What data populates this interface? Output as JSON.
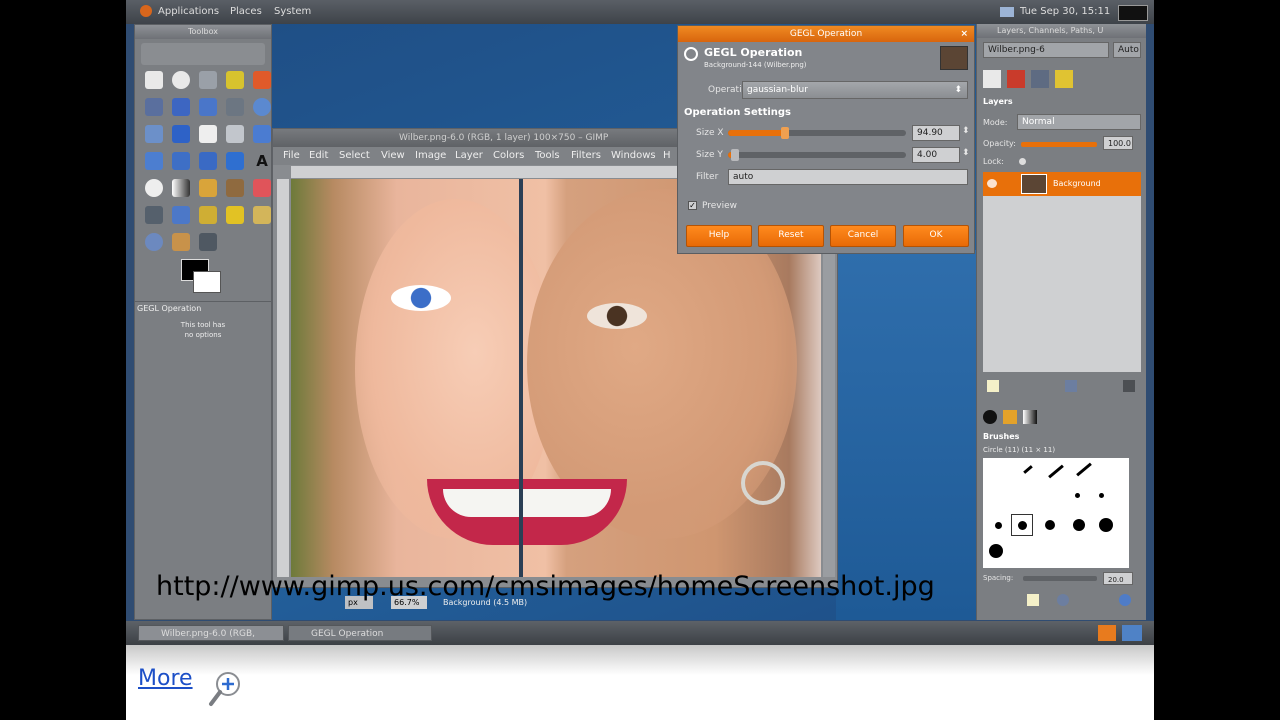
{
  "topbar": {
    "menus": [
      "Applications",
      "Places",
      "System"
    ],
    "clock": "Tue Sep 30, 15:11"
  },
  "toolbox": {
    "title": "Toolbox",
    "options_title": "GEGL Operation",
    "options_text_1": "This tool has",
    "options_text_2": "no options"
  },
  "image_window": {
    "title": "Wilber.png-6.0 (RGB, 1 layer) 100×750 – GIMP",
    "menus": [
      "File",
      "Edit",
      "Select",
      "View",
      "Image",
      "Layer",
      "Colors",
      "Tools",
      "Filters",
      "Windows",
      "H"
    ],
    "status": {
      "unit": "px",
      "zoom": "66.7%",
      "info": "Background (4.5 MB)"
    }
  },
  "gegl_dialog": {
    "window_title": "GEGL Operation",
    "header_title": "GEGL Operation",
    "header_subtitle": "Background-144 (Wilber.png)",
    "operation_label": "Operation:",
    "operation_value": "gaussian-blur",
    "settings_title": "Operation Settings",
    "size_x_label": "Size X",
    "size_x_value": "94.90",
    "size_x_fraction": 0.32,
    "size_y_label": "Size Y",
    "size_y_value": "4.00",
    "size_y_fraction": 0.04,
    "filter_label": "Filter",
    "filter_value": "auto",
    "preview_label": "Preview",
    "buttons": {
      "help": "Help",
      "reset": "Reset",
      "cancel": "Cancel",
      "ok": "OK"
    }
  },
  "layers_dock": {
    "title": "Layers, Channels, Paths, U",
    "image_select": "Wilber.png-6",
    "auto_label": "Auto",
    "section_title": "Layers",
    "mode_label": "Mode:",
    "mode_value": "Normal",
    "opacity_label": "Opacity:",
    "opacity_value": "100.0",
    "lock_label": "Lock:",
    "layer_name": "Background"
  },
  "brushes_dock": {
    "title": "Brushes",
    "brush_name": "Circle (11) (11 × 11)",
    "spacing_label": "Spacing:",
    "spacing_value": "20.0"
  },
  "taskbar": {
    "items": [
      "Wilber.png-6.0 (RGB,",
      "GEGL Operation"
    ]
  },
  "caption": "http://www.gimp.us.com/cmsimages/homeScreenshot.jpg",
  "more_link": "More",
  "colors": {
    "accent": "#e8700a",
    "desktop": "#1f4f86",
    "link": "#1c4fc7"
  }
}
